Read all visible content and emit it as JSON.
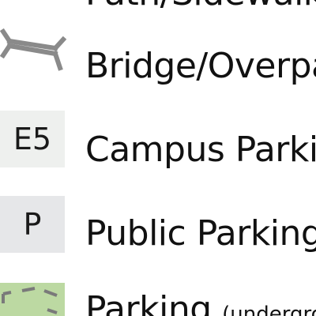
{
  "legend": {
    "items": [
      {
        "label": "Path/Sidewalk",
        "symbol": "path-line-icon"
      },
      {
        "label": "Bridge/Overpass",
        "symbol": "bridge-icon"
      },
      {
        "label": "Campus Parking",
        "badge": "E5",
        "swatch_color": "#eef0ee"
      },
      {
        "label": "Public Parking",
        "badge": "P",
        "swatch_color": "#e6e7e9"
      },
      {
        "label": "Parking",
        "label_suffix": "(underground)",
        "swatch_color": "#bcd9a2",
        "symbol": "underground-parking-icon"
      }
    ]
  },
  "colors": {
    "text": "#111111",
    "bridge_stroke": "#8a8a8a",
    "dash_stroke": "#7a7a7a"
  }
}
